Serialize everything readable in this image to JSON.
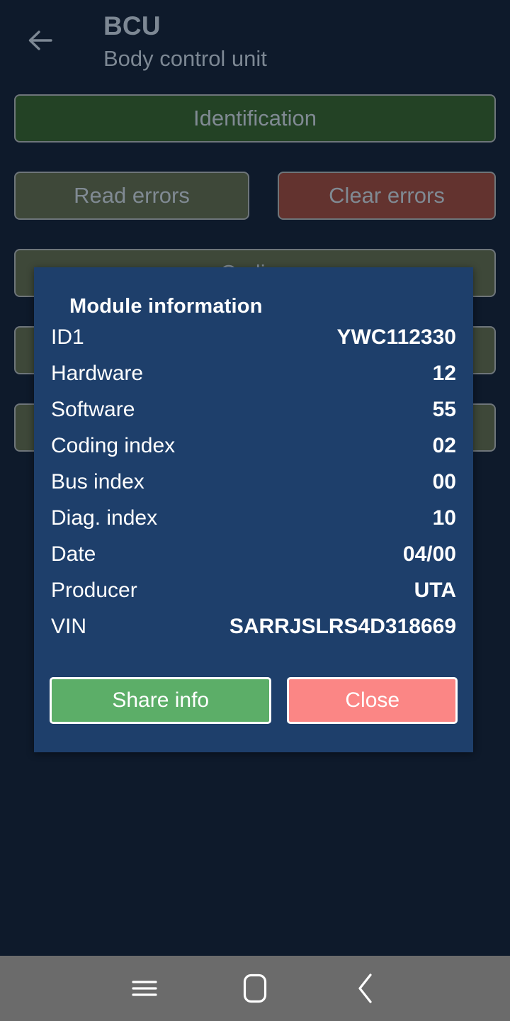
{
  "header": {
    "back_icon": "arrow-left-icon",
    "title": "BCU",
    "subtitle": "Body control unit"
  },
  "actions": [
    {
      "id": "identification",
      "label": "Identification",
      "style": "green"
    },
    {
      "id": "read-errors",
      "label": "Read errors",
      "style": "grey"
    },
    {
      "id": "clear-errors",
      "label": "Clear errors",
      "style": "red"
    },
    {
      "id": "coding",
      "label": "Coding",
      "style": "grey"
    },
    {
      "id": "row4",
      "label": "",
      "style": "grey"
    },
    {
      "id": "row5",
      "label": "",
      "style": "grey"
    }
  ],
  "dialog": {
    "title": "Module information",
    "rows": [
      {
        "label": "ID1",
        "value": "YWC112330"
      },
      {
        "label": "Hardware",
        "value": "12"
      },
      {
        "label": "Software",
        "value": "55"
      },
      {
        "label": "Coding index",
        "value": "02"
      },
      {
        "label": "Bus index",
        "value": "00"
      },
      {
        "label": "Diag. index",
        "value": "10"
      },
      {
        "label": "Date",
        "value": "04/00"
      },
      {
        "label": "Producer",
        "value": "UTA"
      },
      {
        "label": "VIN",
        "value": "SARRJSLRS4D318669"
      }
    ],
    "share_label": "Share info",
    "close_label": "Close"
  },
  "system_nav": {
    "recents_icon": "menu-icon",
    "home_icon": "home-square-icon",
    "back_icon": "chevron-left-icon"
  },
  "colors": {
    "screen_background": "#0e1a2b",
    "dialog_background": "#1e3f6b",
    "button_green": "#234225",
    "button_grey": "#3e4839",
    "button_red": "#63332f",
    "share_green": "#5cae68",
    "close_red": "#fb8685",
    "nav_bar": "#6b6b6b",
    "muted_text": "#7d8894"
  }
}
